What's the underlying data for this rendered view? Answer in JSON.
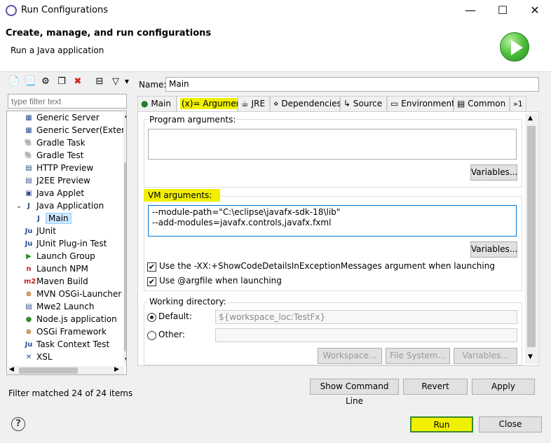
{
  "window": {
    "title": "Run Configurations",
    "minimize": "—",
    "maximize": "☐",
    "close": "✕"
  },
  "header": {
    "title": "Create, manage, and run configurations",
    "subtitle": "Run a Java application"
  },
  "filter": {
    "placeholder": "type filter text",
    "status": "Filter matched 24 of 24 items"
  },
  "tree": {
    "items": [
      {
        "label": "Generic Server",
        "icon": "server-icon"
      },
      {
        "label": "Generic Server(Extern",
        "icon": "server-icon"
      },
      {
        "label": "Gradle Task",
        "icon": "gradle-icon"
      },
      {
        "label": "Gradle Test",
        "icon": "gradle-icon"
      },
      {
        "label": "HTTP Preview",
        "icon": "page-icon"
      },
      {
        "label": "J2EE Preview",
        "icon": "page-icon"
      },
      {
        "label": "Java Applet",
        "icon": "applet-icon"
      },
      {
        "label": "Java Application",
        "icon": "java-app-icon",
        "expanded": true
      },
      {
        "label": "Main",
        "icon": "java-app-icon",
        "selected": true
      },
      {
        "label": "JUnit",
        "icon": "junit-icon"
      },
      {
        "label": "JUnit Plug-in Test",
        "icon": "junit-icon"
      },
      {
        "label": "Launch Group",
        "icon": "launch-group-icon"
      },
      {
        "label": "Launch NPM",
        "icon": "npm-icon"
      },
      {
        "label": "Maven Build",
        "icon": "maven-icon"
      },
      {
        "label": "MVN OSGi-Launcher",
        "icon": "osgi-icon"
      },
      {
        "label": "Mwe2 Launch",
        "icon": "page-icon"
      },
      {
        "label": "Node.js application",
        "icon": "node-icon"
      },
      {
        "label": "OSGi Framework",
        "icon": "osgi-icon"
      },
      {
        "label": "Task Context Test",
        "icon": "junit-icon"
      },
      {
        "label": "XSL",
        "icon": "xsl-icon"
      }
    ]
  },
  "config": {
    "name_label": "Name:",
    "name": "Main",
    "tabs": [
      {
        "label": "Main"
      },
      {
        "label": "Arguments",
        "active": true
      },
      {
        "label": "JRE"
      },
      {
        "label": "Dependencies"
      },
      {
        "label": "Source"
      },
      {
        "label": "Environment"
      },
      {
        "label": "Common"
      },
      {
        "label": "»1"
      }
    ],
    "program_args_label": "Program arguments:",
    "program_args": "",
    "variables_label": "Variables...",
    "vm_args_label": "VM arguments:",
    "vm_args": "--module-path=\"C:\\eclipse\\javafx-sdk-18\\lib\"\n--add-modules=javafx.controls,javafx.fxml",
    "checkbox_xx": {
      "label": "Use the -XX:+ShowCodeDetailsInExceptionMessages argument when launching",
      "checked": true
    },
    "checkbox_argfile": {
      "label": "Use @argfile when launching",
      "checked": true
    },
    "working_dir_label": "Working directory:",
    "default_label": "Default:",
    "default_value": "${workspace_loc:TestFx}",
    "other_label": "Other:",
    "other_value": "",
    "workspace_btn": "Workspace...",
    "filesystem_btn": "File System...",
    "variables_btn2": "Variables..."
  },
  "bottom": {
    "show_command_line": "Show Command Line",
    "revert": "Revert",
    "apply": "Apply",
    "run": "Run",
    "close": "Close",
    "help": "?"
  },
  "colors": {
    "highlight": "#f0f000",
    "run_green": "#4cbf3a"
  }
}
